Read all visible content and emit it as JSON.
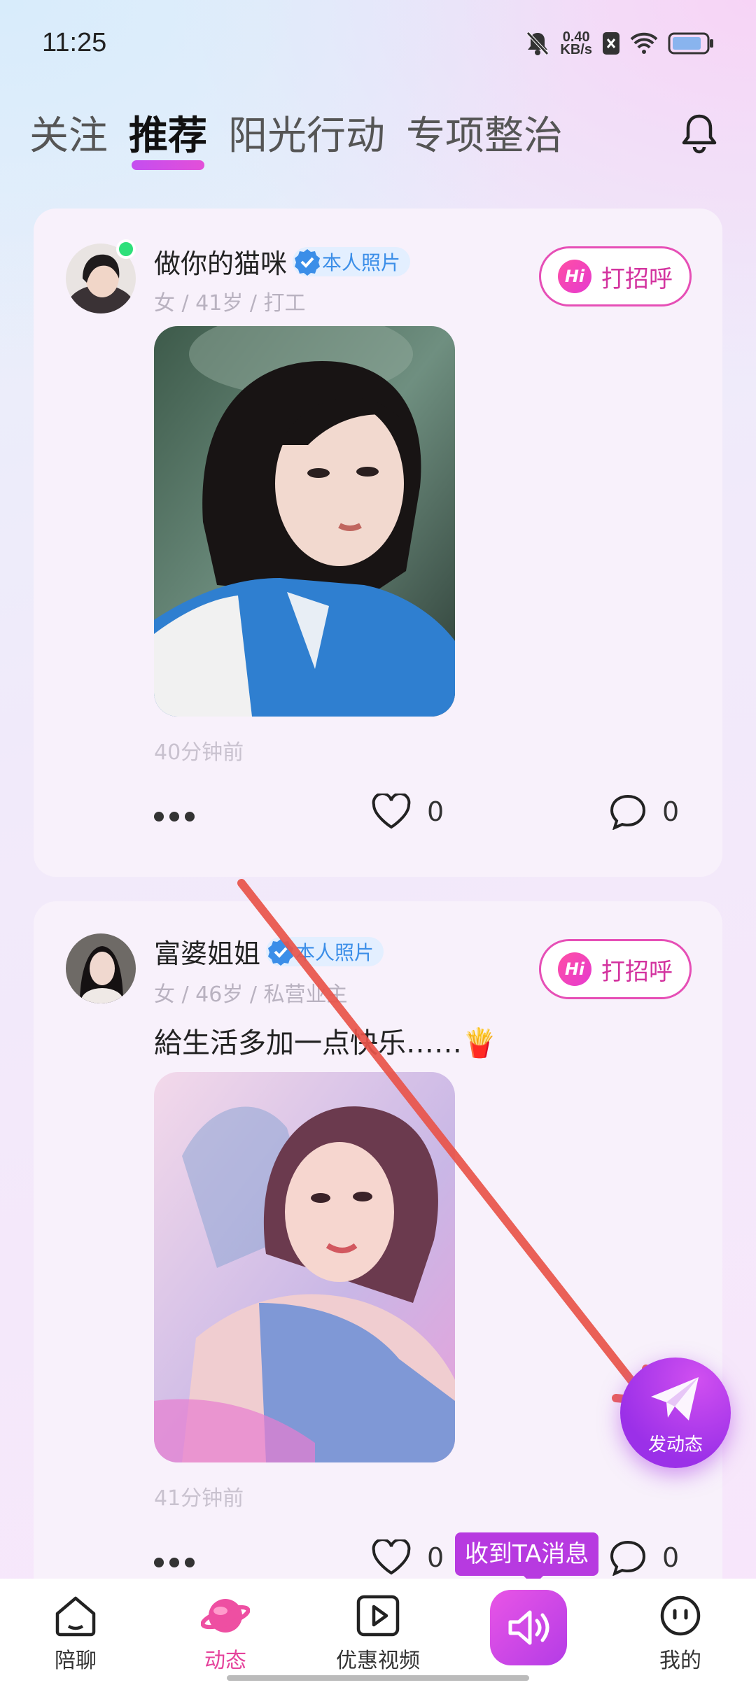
{
  "status": {
    "time": "11:25",
    "speed_value": "0.40",
    "speed_unit": "KB/s"
  },
  "tabs": [
    {
      "label": "关注"
    },
    {
      "label": "推荐"
    },
    {
      "label": "阳光行动"
    },
    {
      "label": "专项整治"
    }
  ],
  "posts": [
    {
      "name": "做你的猫咪",
      "badge": "本人照片",
      "meta": "女 / 41岁 / 打工",
      "greet": "打招呼",
      "time": "40分钟前",
      "likes": "0",
      "comments": "0"
    },
    {
      "name": "富婆姐姐",
      "badge": "本人照片",
      "meta": "女 / 46岁 / 私营业主",
      "caption": "給生活多加一点快乐……🍟",
      "greet": "打招呼",
      "time": "41分钟前",
      "likes": "0",
      "comments": "0"
    }
  ],
  "fab": {
    "label": "发动态"
  },
  "tooltip": "收到TA消息",
  "nav": [
    {
      "label": "陪聊"
    },
    {
      "label": "动态"
    },
    {
      "label": "优惠视频"
    },
    {
      "label": "我的"
    }
  ],
  "colors": {
    "accent": "#c44ef0",
    "greet": "#e64fb6",
    "verified": "#3b8ee8"
  },
  "icons": [
    "bell-icon",
    "hi-icon",
    "verified-icon",
    "more-icon",
    "heart-icon",
    "comment-icon",
    "send-icon",
    "home-icon",
    "planet-icon",
    "play-icon",
    "speaker-icon",
    "smile-icon"
  ]
}
